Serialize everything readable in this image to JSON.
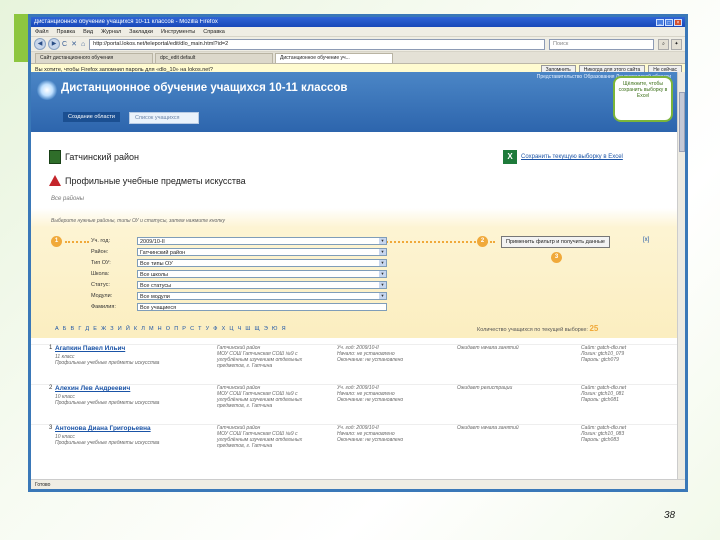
{
  "window": {
    "title": "Дистанционное обучение учащихся 10-11 классов - Mozilla Firefox",
    "menu": [
      "Файл",
      "Правка",
      "Вид",
      "Журнал",
      "Закладки",
      "Инструменты",
      "Справка"
    ],
    "address": "http://portal.lokos.net/teleportal/edit/dlo_main.html?id=2",
    "search_placeholder": "Поиск",
    "tabs": [
      "Сайт дистанционного обучения",
      "dpc_edit default",
      "Дистанционное обучение уч..."
    ],
    "notification": "Вы хотите, чтобы Firefox запомнил пароль для «dlo_10» на lokos.net?",
    "notif_buttons": [
      "Запомнить",
      "Никогда для этого сайта",
      "Не сейчас"
    ],
    "status": "Готово"
  },
  "banner": {
    "title": "Дистанционное обучение учащихся 10-11 классов",
    "tagline": "Представительство Образования Ленинградской области",
    "nav_tabs": [
      "Создание области",
      "Список учащихся"
    ],
    "bubble": "Щёлкните, чтобы сохранить выборку в Excel"
  },
  "page": {
    "region": "Гатчинский район",
    "subject": "Профильные учебные предметы искусства",
    "all_regions": "Все районы",
    "excel_link": "Сохранить текущую выборку в Excel",
    "hint": "Выберите нужные районы, типы ОУ и статусы, затем нажмите кнопку"
  },
  "filters": [
    {
      "label": "Уч. год:",
      "value": "2009/10-II"
    },
    {
      "label": "Район:",
      "value": "Гатчинский район"
    },
    {
      "label": "Тип ОУ:",
      "value": "Все типы ОУ"
    },
    {
      "label": "Школа:",
      "value": "Все школы"
    },
    {
      "label": "Статус:",
      "value": "Все статусы"
    },
    {
      "label": "Модули:",
      "value": "Все модули"
    },
    {
      "label": "Фамилия:",
      "value": "Все учащиеся"
    }
  ],
  "apply_button": "Применить фильтр и получить данные",
  "reset_mark": "[x]",
  "steps": [
    "1",
    "2",
    "3"
  ],
  "alphabet": "А Б В Г Д Е Ж З И Й К Л М Н О П Р С Т У Ф Х Ц Ч Ш Щ Э Ю Я",
  "count_label": "Количество учащихся по текущей выборке:",
  "count_value": "25",
  "students": [
    {
      "num": "1",
      "name": "Агапкин Павел Ильич",
      "grade": "11 класс",
      "subject": "Профильные учебные предметы искусства",
      "school": [
        "Гатчинский район",
        "МОУ СОШ Гатчинская СОШ №9 с",
        "углублённым изучением отдельных",
        "предметов, г. Гатчина"
      ],
      "dates": [
        "Уч. год: 2009/10-II",
        "Начало: не установлено",
        "Окончание: не установлено"
      ],
      "status": "Ожидает начала занятий",
      "login": [
        "Сайт: gatch-dlo.net",
        "Логин: gtch10_079",
        "Пароль: gtch079"
      ]
    },
    {
      "num": "2",
      "name": "Алехин Лев Андреевич",
      "grade": "10 класс",
      "subject": "Профильные учебные предметы искусства",
      "school": [
        "Гатчинский район",
        "МОУ СОШ Гатчинская СОШ №9 с",
        "углублённым изучением отдельных",
        "предметов, г. Гатчина"
      ],
      "dates": [
        "Уч. год: 2009/10-II",
        "Начало: не установлено",
        "Окончание: не установлено"
      ],
      "status": "Ожидает регистрации",
      "login": [
        "Сайт: gatch-dlo.net",
        "Логин: gtch10_081",
        "Пароль: gtch081"
      ]
    },
    {
      "num": "3",
      "name": "Антонова Диана Григорьевна",
      "grade": "10 класс",
      "subject": "Профильные учебные предметы искусства",
      "school": [
        "Гатчинский район",
        "МОУ СОШ Гатчинская СОШ №9 с",
        "углублённым изучением отдельных",
        "предметов, г. Гатчина"
      ],
      "dates": [
        "Уч. год: 2009/10-II",
        "Начало: не установлено",
        "Окончание: не установлено"
      ],
      "status": "Ожидает начала занятий",
      "login": [
        "Сайт: gatch-dlo.net",
        "Логин: gtch10_083",
        "Пароль: gtch083"
      ]
    }
  ],
  "page_number": "38",
  "colors": {
    "frame": "#3a78b8",
    "banner": "#2d65ad",
    "accent": "#f0a93a",
    "link": "#1a53a6"
  }
}
